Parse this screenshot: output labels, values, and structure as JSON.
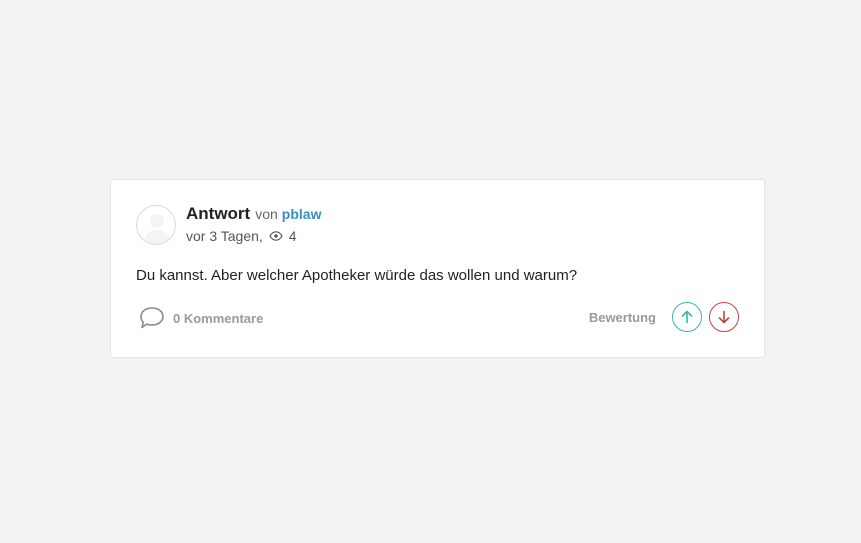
{
  "answer": {
    "title": "Antwort",
    "by_label": "von",
    "author": "pblaw",
    "time_ago": "vor 3 Tagen,",
    "views": "4",
    "text": "Du kannst. Aber welcher Apotheker würde das wollen und warum?"
  },
  "footer": {
    "comments_label": "0 Kommentare",
    "rating_label": "Bewertung"
  },
  "icons": {
    "avatar": "avatar-placeholder-icon",
    "views": "eye-icon",
    "comments": "comment-bubble-icon",
    "upvote": "arrow-up-icon",
    "downvote": "arrow-down-icon"
  },
  "colors": {
    "background": "#f2f2f2",
    "card": "#ffffff",
    "author_link": "#3a8fc2",
    "upvote": "#3bb6a6",
    "downvote": "#c9403f"
  }
}
